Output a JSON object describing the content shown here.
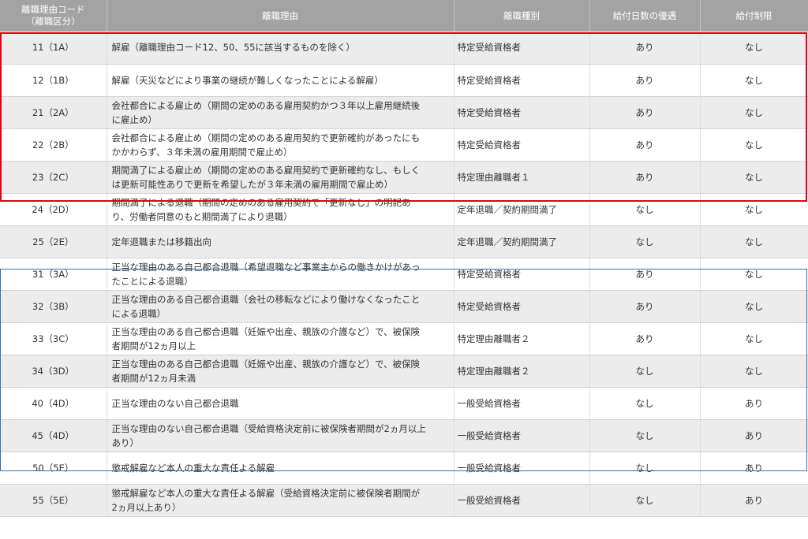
{
  "header": {
    "col_code_line1": "離職理由コード",
    "col_code_line2": "（離職区分）",
    "col_reason": "離職理由",
    "col_type": "離職種別",
    "col_priority": "給付日数の優遇",
    "col_restriction": "給付制限"
  },
  "rows": [
    {
      "code": "11（1A）",
      "reason_1": "解雇（離職理由コード12、50、55に該当するものを除く）",
      "reason_2": "",
      "type": "特定受給資格者",
      "priority": "あり",
      "restriction": "なし"
    },
    {
      "code": "12（1B）",
      "reason_1": "解雇（天災などにより事業の継続が難しくなったことによる解雇）",
      "reason_2": "",
      "type": "特定受給資格者",
      "priority": "あり",
      "restriction": "なし"
    },
    {
      "code": "21（2A）",
      "reason_1": "会社都合による雇止め（期間の定めのある雇用契約かつ３年以上雇用継続後",
      "reason_2": "に雇止め）",
      "type": "特定受給資格者",
      "priority": "あり",
      "restriction": "なし"
    },
    {
      "code": "22（2B）",
      "reason_1": "会社都合による雇止め（期間の定めのある雇用契約で更新確約があったにも",
      "reason_2": "かかわらず、３年未満の雇用期間で雇止め）",
      "type": "特定受給資格者",
      "priority": "あり",
      "restriction": "なし"
    },
    {
      "code": "23（2C）",
      "reason_1": "期間満了による雇止め（期間の定めのある雇用契約で更新確約なし、もしく",
      "reason_2": "は更新可能性ありで更新を希望したが３年未満の雇用期間で雇止め）",
      "type": "特定理由離職者１",
      "priority": "あり",
      "restriction": "なし"
    },
    {
      "code": "24（2D）",
      "reason_1": "期間満了による退職（期間の定めのある雇用契約で「更新なし」の明記あ",
      "reason_2": "り、労働者同意のもと期間満了により退職）",
      "type": "定年退職／契約期間満了",
      "priority": "なし",
      "restriction": "なし"
    },
    {
      "code": "25（2E）",
      "reason_1": "定年退職または移籍出向",
      "reason_2": "",
      "type": "定年退職／契約期間満了",
      "priority": "なし",
      "restriction": "なし"
    },
    {
      "code": "31（3A）",
      "reason_1": "正当な理由のある自己都合退職（希望退職など事業主からの働きかけがあっ",
      "reason_2": "たことによる退職）",
      "type": "特定受給資格者",
      "priority": "あり",
      "restriction": "なし"
    },
    {
      "code": "32（3B）",
      "reason_1": "正当な理由のある自己都合退職（会社の移転などにより働けなくなったこと",
      "reason_2": "による退職）",
      "type": "特定受給資格者",
      "priority": "あり",
      "restriction": "なし"
    },
    {
      "code": "33（3C）",
      "reason_1": "正当な理由のある自己都合退職（妊娠や出産、親族の介護など）で、被保険",
      "reason_2": "者期間が12ヵ月以上",
      "type": "特定理由離職者２",
      "priority": "あり",
      "restriction": "なし"
    },
    {
      "code": "34（3D）",
      "reason_1": "正当な理由のある自己都合退職（妊娠や出産、親族の介護など）で、被保険",
      "reason_2": "者期間が12ヵ月未満",
      "type": "特定理由離職者２",
      "priority": "なし",
      "restriction": "なし"
    },
    {
      "code": "40（4D）",
      "reason_1": "正当な理由のない自己都合退職",
      "reason_2": "",
      "type": "一般受給資格者",
      "priority": "なし",
      "restriction": "あり"
    },
    {
      "code": "45（4D）",
      "reason_1": "正当な理由のない自己都合退職（受給資格決定前に被保険者期間が2ヵ月以上",
      "reason_2": "あり）",
      "type": "一般受給資格者",
      "priority": "なし",
      "restriction": "あり"
    },
    {
      "code": "50（5E）",
      "reason_1": "懲戒解雇など本人の重大な責任よる解雇",
      "reason_2": "",
      "type": "一般受給資格者",
      "priority": "なし",
      "restriction": "あり"
    },
    {
      "code": "55（5E）",
      "reason_1": "懲戒解雇など本人の重大な責任よる解雇（受給資格決定前に被保険者期間が",
      "reason_2": "2ヵ月以上あり）",
      "type": "一般受給資格者",
      "priority": "なし",
      "restriction": "あり"
    }
  ],
  "highlights": {
    "red_group_color": "#e60012",
    "blue_group_color": "#2e75b6"
  }
}
